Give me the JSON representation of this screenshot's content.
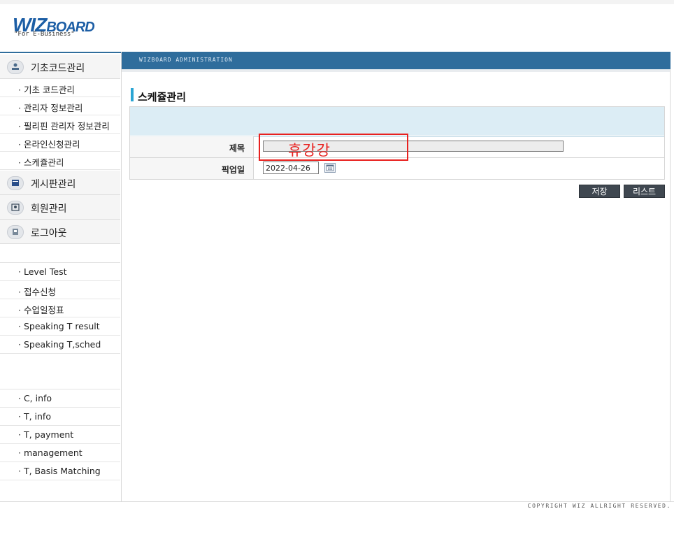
{
  "logo": {
    "wiz": "WIZ",
    "board": "BOARD",
    "tagline": "\"For E-Business\""
  },
  "admin_bar": {
    "label": "WIZBOARD ADMINISTRATION"
  },
  "sidebar": {
    "sections": [
      {
        "label": "기초코드관리",
        "icon": "user-icon"
      },
      {
        "label": "게시판관리",
        "icon": "board-icon"
      },
      {
        "label": "회원관리",
        "icon": "member-icon"
      },
      {
        "label": "로그아웃",
        "icon": "logout-icon"
      }
    ],
    "base_items": [
      {
        "label": "· 기초 코드관리"
      },
      {
        "label": "· 관리자 정보관리"
      },
      {
        "label": "· 필리핀 관리자 정보관리"
      },
      {
        "label": "· 온라인신청관리"
      },
      {
        "label": "· 스케쥴관리"
      }
    ],
    "group2_items": [
      {
        "label": "· Level Test"
      },
      {
        "label": "· 접수신청"
      },
      {
        "label": "· 수업일정표"
      },
      {
        "label": "· Speaking T result"
      },
      {
        "label": "· Speaking T,sched"
      }
    ],
    "group3_items": [
      {
        "label": "· C, info"
      },
      {
        "label": "· T, info"
      },
      {
        "label": "· T, payment"
      },
      {
        "label": "· management"
      },
      {
        "label": "· T, Basis Matching"
      }
    ]
  },
  "page": {
    "title": "스케쥴관리",
    "form": {
      "subject_label": "제목",
      "subject_value": "",
      "date_label": "픽업일",
      "date_value": "2022-04-26"
    },
    "overlay_text": "휴강강",
    "buttons": {
      "save": "저장",
      "list": "리스트"
    }
  },
  "footer": {
    "copyright": "COPYRIGHT WIZ ALLRIGHT RESERVED."
  },
  "colors": {
    "accent": "#2f6d9c",
    "title_bar": "#2aa5d4",
    "highlight": "#e8211f",
    "button": "#3f4750"
  }
}
